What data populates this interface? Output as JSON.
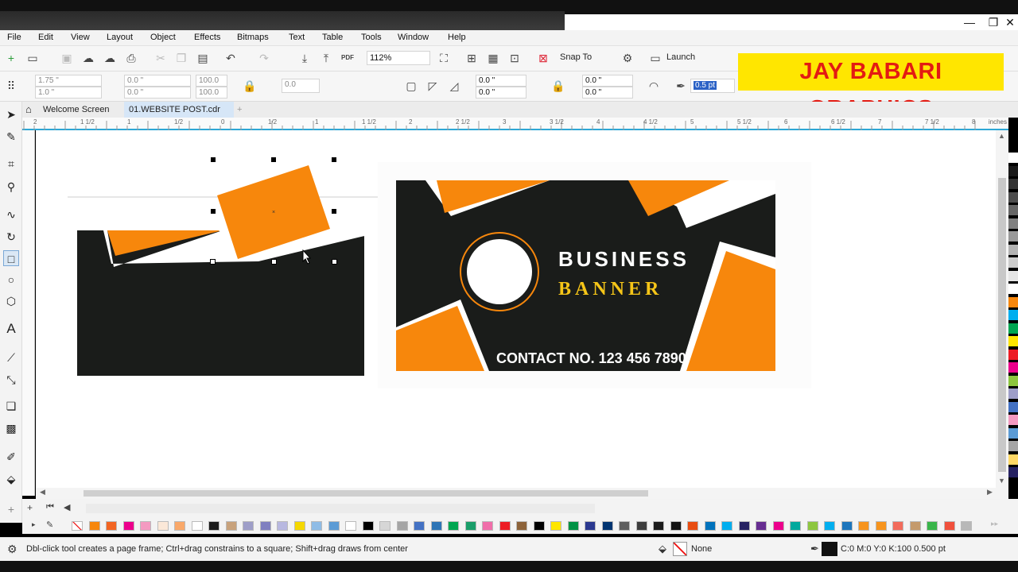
{
  "window": {
    "minimize": "—",
    "restore": "❐",
    "close": "✕"
  },
  "menu": [
    "File",
    "Edit",
    "View",
    "Layout",
    "Object",
    "Effects",
    "Bitmaps",
    "Text",
    "Table",
    "Tools",
    "Window",
    "Help"
  ],
  "toolbar": {
    "zoom": "112%",
    "snap_label": "Snap To",
    "launch_label": "Launch",
    "pdf_label": "PDF"
  },
  "props": {
    "x": "1.75 \"",
    "y": "1.0 \"",
    "w": "0.0 \"",
    "h": "0.0 \"",
    "scale_w": "100.0",
    "scale_h": "100.0",
    "angle": "0.0",
    "corner1": "0.0 \"",
    "corner2": "0.0 \"",
    "corner3": "0.0 \"",
    "corner4": "0.0 \"",
    "outline": "0.5 pt"
  },
  "brand": "JAY BABARI GRAPHICS",
  "tabs": {
    "welcome": "Welcome Screen",
    "document": "01.WEBSITE POST.cdr",
    "add": "+"
  },
  "ruler": {
    "units": "inches",
    "labels": [
      "2",
      "1 1/2",
      "1",
      "1/2",
      "0",
      "1/2",
      "1",
      "1 1/2",
      "2",
      "2 1/2",
      "3",
      "3 1/2",
      "4",
      "4 1/2",
      "5",
      "5 1/2",
      "6",
      "6 1/2",
      "7",
      "7 1/2",
      "8"
    ]
  },
  "banner": {
    "line1": "BUSINESS",
    "line2": "BANNER",
    "contact": "CONTACT NO. 123 456 7890"
  },
  "status": {
    "hint": "Dbl-click tool creates a page frame; Ctrl+drag constrains to a square; Shift+drag draws from center",
    "fill": "None",
    "outline": "C:0 M:0 Y:0 K:100  0.500 pt"
  },
  "colors": {
    "orange": "#f7870c",
    "dark": "#1a1c1a",
    "yellow": "#f5c518",
    "accent": "#2da7d6"
  },
  "palette": [
    "#ffffff",
    "#f7870c",
    "#f26522",
    "#ec008c",
    "#f49ac1",
    "#fbe8d8",
    "#f9a869",
    "#ffffff",
    "#1a1a1a",
    "#c8a27c",
    "#9e9ec8",
    "#8080c0",
    "#b8b8e0",
    "#f5d800",
    "#8fbce6",
    "#5b9bd5",
    "#ffffff",
    "#000000",
    "#d6d6d6",
    "#a5a5a5",
    "#4472c4",
    "#2e75b6",
    "#00a651",
    "#1a9e6a",
    "#f06eaa",
    "#ed1c24",
    "#8c6239",
    "#000000",
    "#ffe600",
    "#009245",
    "#2b3990",
    "#003471",
    "#5e5e5e",
    "#3d3d3d",
    "#1b1b1b",
    "#121212",
    "#e84c10",
    "#0072bc",
    "#00aeef",
    "#262262",
    "#662d91",
    "#ec008c",
    "#00a99d",
    "#8dc63f",
    "#00aeef",
    "#1c75bc",
    "#f7941d",
    "#f7941d",
    "#f26b5b",
    "#c49a6c",
    "#39b54a",
    "#f0503c",
    "#b8b8b8"
  ],
  "side_palette": [
    "#ffffff",
    "#1a1a1a",
    "#333333",
    "#4d4d4d",
    "#666666",
    "#808080",
    "#999999",
    "#b3b3b3",
    "#cccccc",
    "#e6e6e6",
    "#ffffff",
    "#f7870c",
    "#00aeef",
    "#00a651",
    "#ffe600",
    "#ed1c24",
    "#ec008c",
    "#8dc63f",
    "#9e9ec8",
    "#4472c4",
    "#f49ac1",
    "#5b9bd5",
    "#a5a5a5",
    "#ffd966",
    "#262262"
  ]
}
